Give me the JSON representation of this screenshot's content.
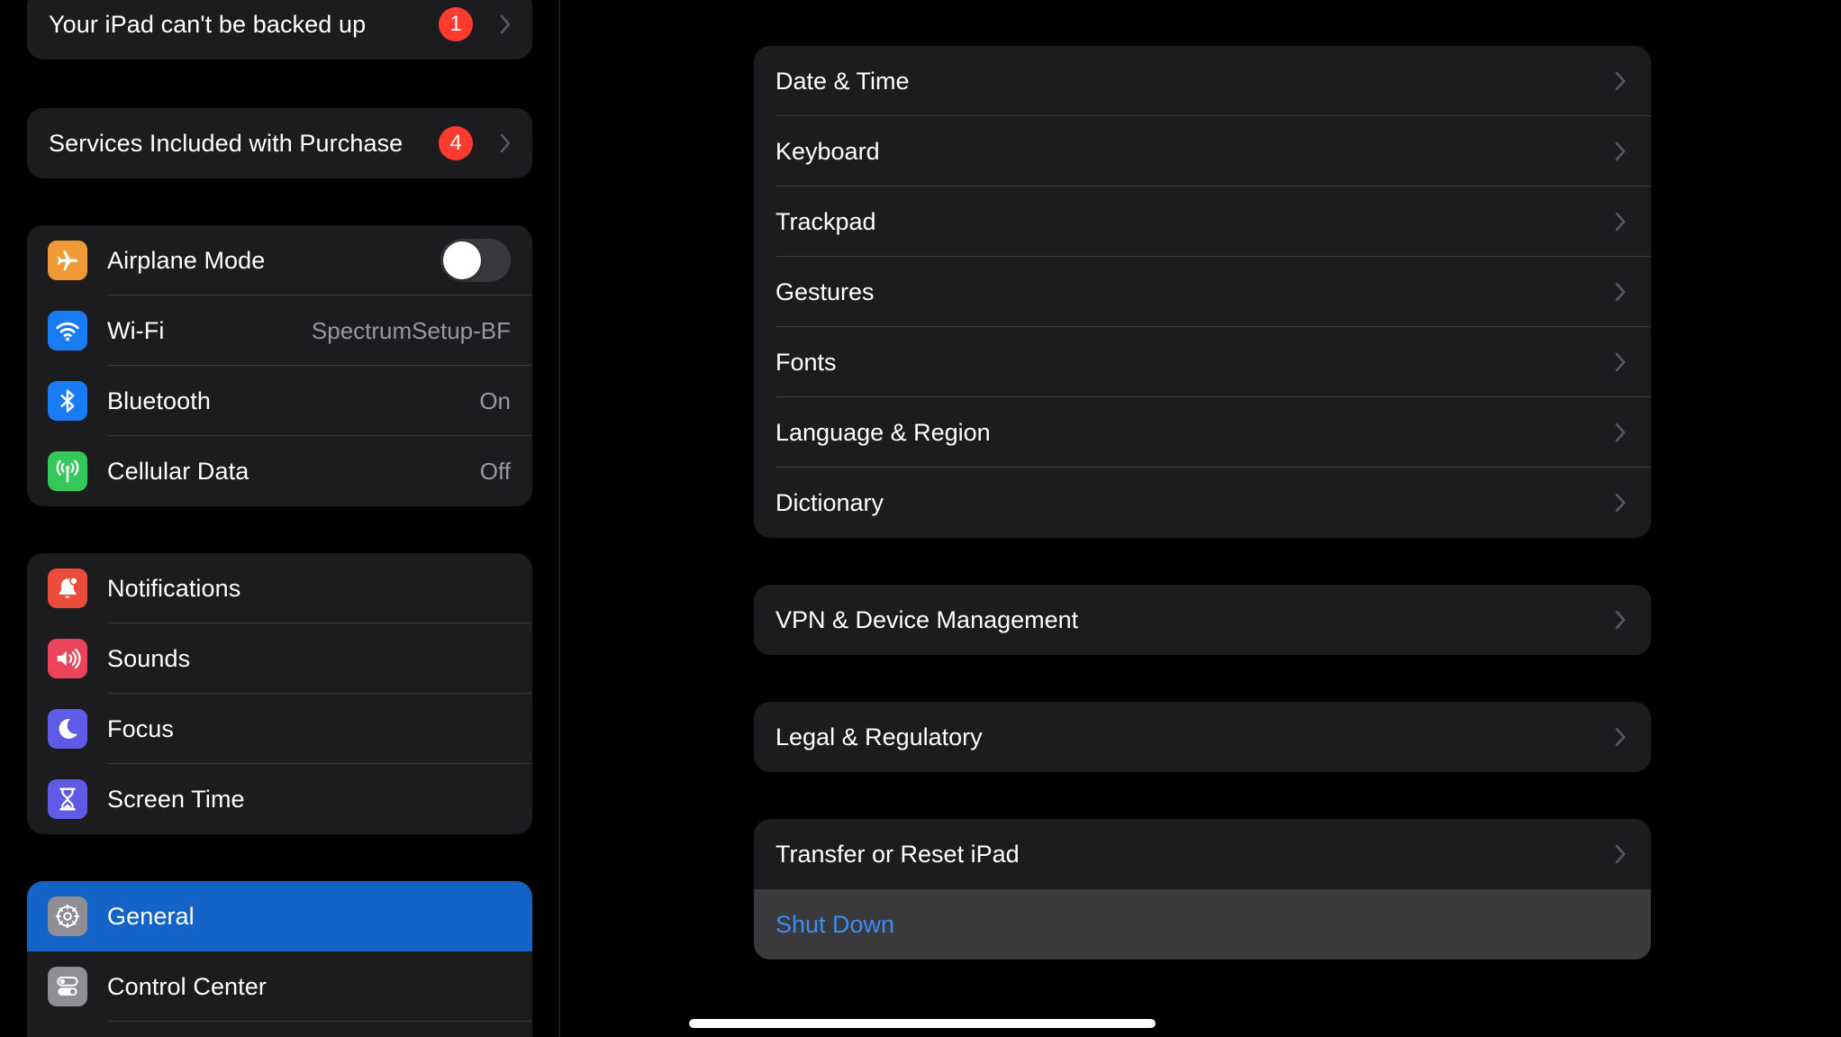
{
  "sidebar": {
    "backup": {
      "label": "Your iPad can't be backed up",
      "badge": "1"
    },
    "services": {
      "label": "Services Included with Purchase",
      "badge": "4"
    },
    "connectivity": [
      {
        "label": "Airplane Mode",
        "icon": "airplane-icon",
        "color": "#f09a37",
        "toggle": "off"
      },
      {
        "label": "Wi-Fi",
        "icon": "wifi-icon",
        "color": "#1a7cf5",
        "value": "SpectrumSetup-BF"
      },
      {
        "label": "Bluetooth",
        "icon": "bluetooth-icon",
        "color": "#1a7cf5",
        "value": "On"
      },
      {
        "label": "Cellular Data",
        "icon": "antenna-icon",
        "color": "#34c759",
        "value": "Off"
      }
    ],
    "alerts": [
      {
        "label": "Notifications",
        "icon": "bell-icon",
        "color": "#eb4d3d"
      },
      {
        "label": "Sounds",
        "icon": "speaker-icon",
        "color": "#eb445a"
      },
      {
        "label": "Focus",
        "icon": "moon-icon",
        "color": "#5e5ce6"
      },
      {
        "label": "Screen Time",
        "icon": "hourglass-icon",
        "color": "#5e5ce6"
      }
    ],
    "system": [
      {
        "label": "General",
        "icon": "gear-icon",
        "color": "#8e8e93",
        "selected": true
      },
      {
        "label": "Control Center",
        "icon": "switches-icon",
        "color": "#8e8e93"
      }
    ]
  },
  "main": {
    "group1": [
      {
        "label": "Date & Time"
      },
      {
        "label": "Keyboard"
      },
      {
        "label": "Trackpad"
      },
      {
        "label": "Gestures"
      },
      {
        "label": "Fonts"
      },
      {
        "label": "Language & Region"
      },
      {
        "label": "Dictionary"
      }
    ],
    "group2": [
      {
        "label": "VPN & Device Management"
      }
    ],
    "group3": [
      {
        "label": "Legal & Regulatory"
      }
    ],
    "group4": [
      {
        "label": "Transfer or Reset iPad"
      },
      {
        "label": "Shut Down"
      }
    ]
  },
  "colors": {
    "accent_blue": "#3a8ef6",
    "selected_row": "#1464c8",
    "badge_red": "#ff3b30",
    "group_bg": "#1c1c1e"
  }
}
